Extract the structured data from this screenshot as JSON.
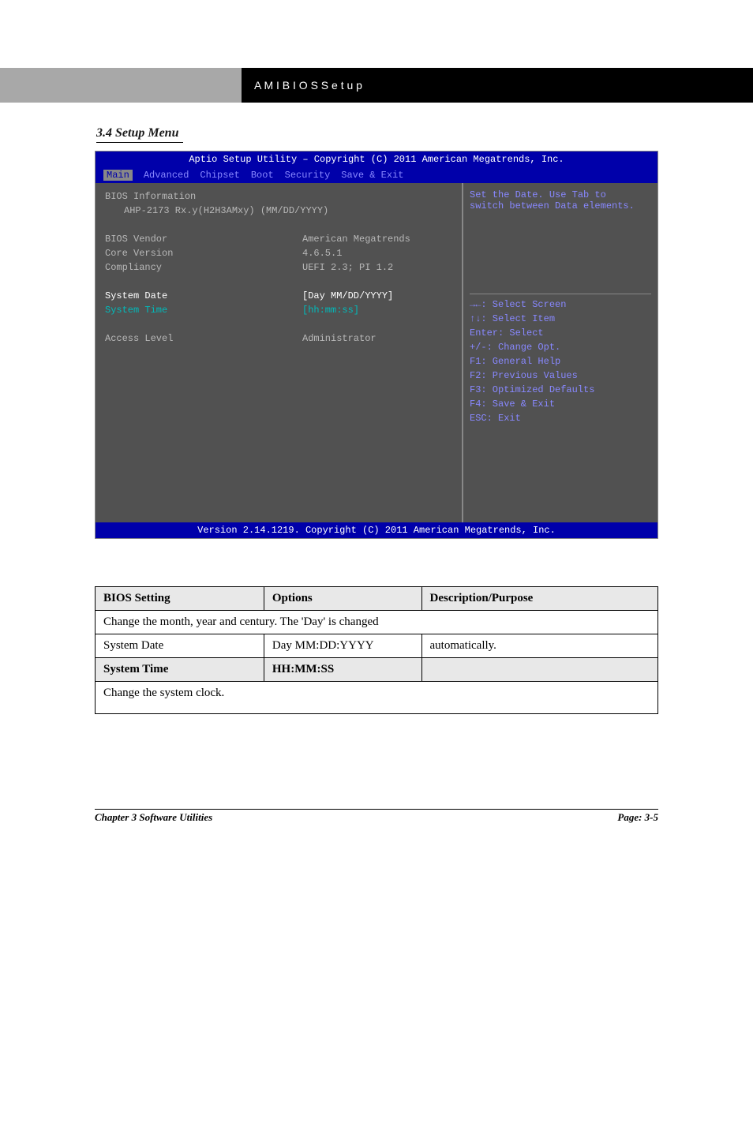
{
  "header": {
    "title_black_left": "A M I   B I O S   S e t u p",
    "title_black_right": ""
  },
  "section_title": "3.4 Setup Menu",
  "bios": {
    "top": "Aptio Setup Utility – Copyright (C) 2011 American Megatrends, Inc.",
    "menu": {
      "active": "Main",
      "items": [
        "Advanced",
        "Chipset",
        "Boot",
        "Security",
        "Save & Exit"
      ]
    },
    "left": {
      "bios_info": "BIOS Information",
      "model": "AHP-2173 Rx.y(H2H3AMxy) (MM/DD/YYYY)",
      "rows": [
        {
          "label": "BIOS Vendor",
          "value": "American Megatrends"
        },
        {
          "label": "Core Version",
          "value": "4.6.5.1"
        },
        {
          "label": "Compliancy",
          "value": "UEFI 2.3; PI 1.2"
        }
      ],
      "date_label": "System Date",
      "date_value": "[Day MM/DD/YYYY]",
      "time_label": "System Time",
      "time_value": "[hh:mm:ss]",
      "access_label": "Access Level",
      "access_value": "Administrator"
    },
    "right": {
      "help_line1": "Set the Date. Use Tab to",
      "help_line2": "switch between Data elements.",
      "keys": [
        "→←: Select Screen",
        "↑↓: Select Item",
        "Enter: Select",
        "+/-: Change Opt.",
        "F1: General Help",
        "F2: Previous Values",
        "F3: Optimized Defaults",
        "F4: Save & Exit",
        "ESC: Exit"
      ]
    },
    "footer": "Version 2.14.1219. Copyright (C) 2011 American Megatrends, Inc."
  },
  "table": {
    "header": [
      "BIOS Setting",
      "Options",
      "Description/Purpose"
    ],
    "r1c0": "System Date",
    "r1c1": "Day MM:DD:YYYY",
    "r1c2_l1": "Change the month, year and century. The 'Day' is changed",
    "r1c2_l2": "automatically.",
    "r2c0": "System Time",
    "r2c1": "HH:MM:SS",
    "r2c2": "Change the system clock."
  },
  "footer": {
    "left": "Chapter 3   Software Utilities",
    "right": "Page: 3-5"
  }
}
